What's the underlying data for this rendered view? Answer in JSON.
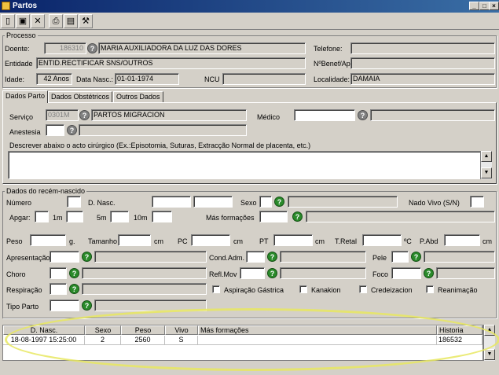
{
  "window": {
    "title": "Partos"
  },
  "toolbar": {
    "icons": [
      "new-doc-icon",
      "close-icon",
      "print-icon",
      "preview-icon",
      "tool-icon"
    ]
  },
  "processo": {
    "group_title": "Processo",
    "doente_label": "Doente:",
    "doente_id": "186310",
    "doente_nome": "MARIA AUXILIADORA DA LUZ DAS DORES",
    "telefone_label": "Telefone:",
    "telefone_value": "",
    "entidade_label": "Entidade",
    "entidade_value": "ENTID.RECTIFICAR SNS/OUTROS",
    "nbenef_label": "NºBenef/Ap",
    "nbenef_value": "",
    "idade_label": "Idade:",
    "idade_value": "42 Anos",
    "data_nasc_label": "Data Nasc.:",
    "data_nasc_value": "01-01-1974",
    "ncu_label": "NCU",
    "ncu_value": "",
    "localidade_label": "Localidade:",
    "localidade_value": "DAMAIA"
  },
  "tabs": [
    {
      "label": "Dados Parto"
    },
    {
      "label": "Dados Obstétricos"
    },
    {
      "label": "Outros Dados"
    }
  ],
  "dados_parto": {
    "servico_label": "Serviço",
    "servico_code": "0301M",
    "servico_nome": "PARTOS MIGRACION",
    "medico_label": "Médico",
    "medico_value": "",
    "anestesia_label": "Anestesia",
    "anestesia_value": "",
    "descrever_label": "Descrever abaixo o acto cirúrgico (Ex.:Episotomia, Suturas, Extracção Normal de placenta, etc.)",
    "descrever_value": ""
  },
  "recem_nascido": {
    "group_title": "Dados do recém-nascido",
    "numero_label": "Número",
    "dnasc_label": "D. Nasc.",
    "sexo_label": "Sexo",
    "nado_vivo_label": "Nado Vivo (S/N)",
    "apgar_label": "Apgar:",
    "m1_label": "1m",
    "m5_label": "5m",
    "m10_label": "10m",
    "mas_formacoes_label": "Más formações",
    "peso_label": "Peso",
    "peso_unit": "g.",
    "tamanho_label": "Tamanho",
    "tamanho_unit": "cm",
    "pc_label": "PC",
    "pc_unit": "cm",
    "pt_label": "PT",
    "pt_unit": "cm",
    "tretal_label": "T.Retal",
    "tretal_unit": "ºC",
    "pabd_label": "P.Abd",
    "pabd_unit": "cm",
    "apresentacao_label": "Apresentação",
    "cond_adm_label": "Cond.Adm.",
    "pele_label": "Pele",
    "choro_label": "Choro",
    "refl_mov_label": "Refl.Mov",
    "foco_label": "Foco",
    "respiracao_label": "Respiração",
    "aspiracao_label": "Aspiração Gástrica",
    "kanakion_label": "Kanakion",
    "credeizacion_label": "Credeizacion",
    "reanimacao_label": "Reanimação",
    "tipo_parto_label": "Tipo Parto"
  },
  "grid": {
    "columns": [
      "D. Nasc.",
      "Sexo",
      "Peso",
      "Vivo",
      "Más formações",
      "Historia"
    ],
    "rows": [
      {
        "dnasc": "18-08-1997 15:25:00",
        "sexo": "2",
        "peso": "2560",
        "vivo": "S",
        "mas": "",
        "historia": "186532"
      }
    ]
  }
}
